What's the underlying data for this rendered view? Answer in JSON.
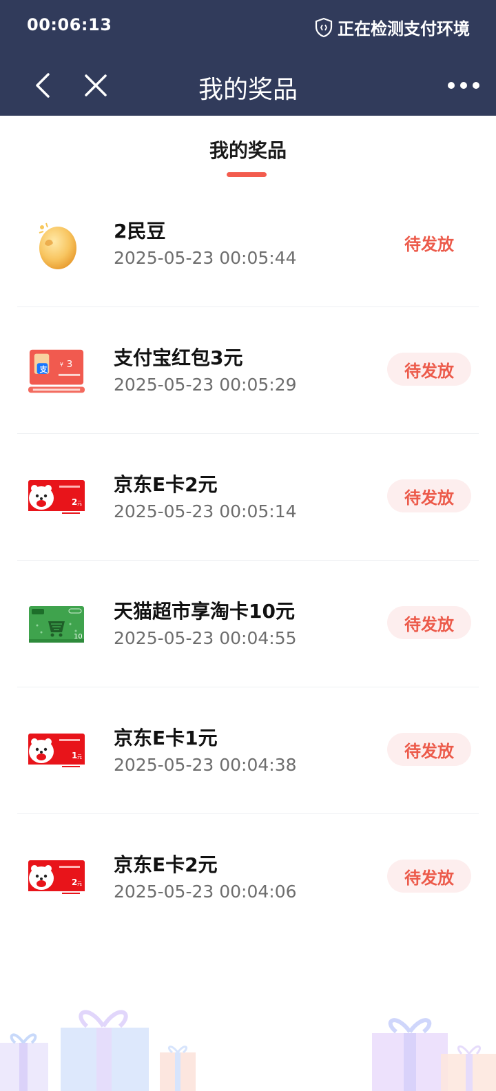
{
  "statusbar": {
    "time": "00:06:13",
    "security_text": "正在检测支付环境"
  },
  "navbar": {
    "title": "我的奖品"
  },
  "tab": {
    "label": "我的奖品"
  },
  "prizes": [
    {
      "name": "2民豆",
      "time": "2025-05-23 00:05:44",
      "status": "待发放",
      "icon": "bean-icon"
    },
    {
      "name": "支付宝红包3元",
      "time": "2025-05-23 00:05:29",
      "status": "待发放",
      "icon": "alipay-red-packet-icon",
      "amount": "3"
    },
    {
      "name": "京东E卡2元",
      "time": "2025-05-23 00:05:14",
      "status": "待发放",
      "icon": "jd-ecard-icon",
      "amount": "2"
    },
    {
      "name": "天猫超市享淘卡10元",
      "time": "2025-05-23 00:04:55",
      "status": "待发放",
      "icon": "tmall-card-icon",
      "amount": "10"
    },
    {
      "name": "京东E卡1元",
      "time": "2025-05-23 00:04:38",
      "status": "待发放",
      "icon": "jd-ecard-icon",
      "amount": "1"
    },
    {
      "name": "京东E卡2元",
      "time": "2025-05-23 00:04:06",
      "status": "待发放",
      "icon": "jd-ecard-icon",
      "amount": "2"
    }
  ],
  "colors": {
    "header_bg": "#313b5b",
    "accent": "#ec5a4a",
    "status_bg": "#fdeeee"
  }
}
